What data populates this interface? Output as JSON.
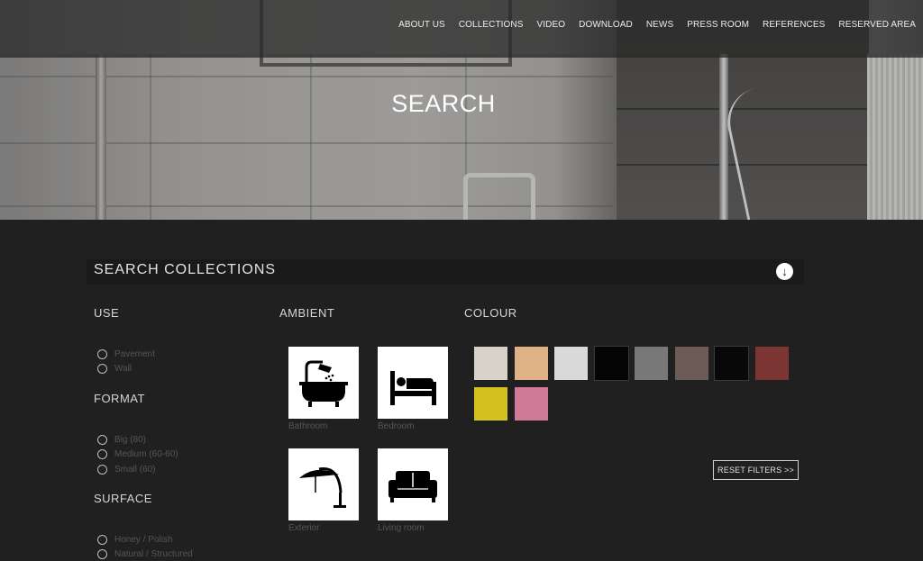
{
  "nav": {
    "items": [
      "ABOUT US",
      "COLLECTIONS",
      "VIDEO",
      "DOWNLOAD",
      "NEWS",
      "PRESS ROOM",
      "REFERENCES",
      "RESERVED AREA"
    ]
  },
  "hero": {
    "title": "SEARCH"
  },
  "search": {
    "title": "SEARCH COLLECTIONS",
    "toggle_icon": "arrow-down-circle-icon"
  },
  "use": {
    "heading": "USE",
    "options": [
      "Pavement",
      "Wall"
    ]
  },
  "format": {
    "heading": "FORMAT",
    "options": [
      "Big (80)",
      "Medium (60-60)",
      "Small (60)"
    ]
  },
  "surface": {
    "heading": "SURFACE",
    "options": [
      "Honey / Polish",
      "Natural / Structured"
    ]
  },
  "ambient": {
    "heading": "AMBIENT",
    "items": [
      {
        "label": "Bathroom",
        "icon": "bathtub-icon"
      },
      {
        "label": "Bedroom",
        "icon": "bed-icon"
      },
      {
        "label": "Exterior",
        "icon": "parasol-icon"
      },
      {
        "label": "Living room",
        "icon": "sofa-icon"
      }
    ]
  },
  "colour": {
    "heading": "COLOUR",
    "swatches": [
      "#d9d2c8",
      "#deb187",
      "#d9d9d9",
      "#050505",
      "#787878",
      "#6d5b55",
      "#080808",
      "#7b3533",
      "#d2c11f",
      "#d07a98"
    ]
  },
  "reset": {
    "label": "RESET FILTERS >>"
  }
}
